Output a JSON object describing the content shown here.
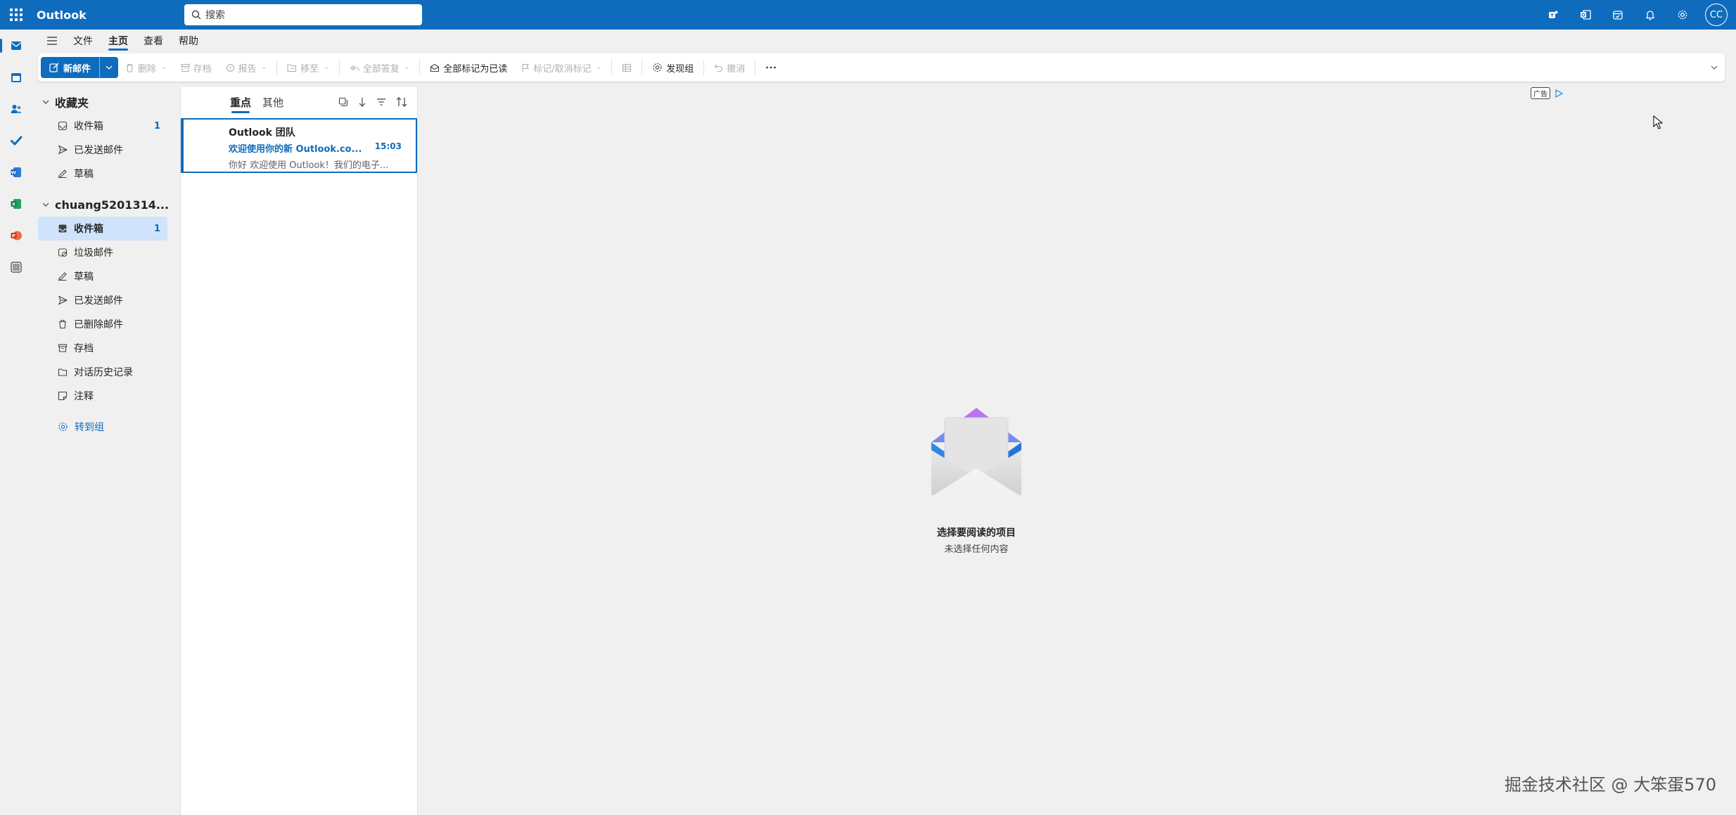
{
  "app": {
    "title": "Outlook"
  },
  "search": {
    "placeholder": "搜索"
  },
  "header": {
    "avatar_initials": "CC"
  },
  "ribbon_tabs": [
    {
      "label": "文件"
    },
    {
      "label": "主页"
    },
    {
      "label": "查看"
    },
    {
      "label": "帮助"
    }
  ],
  "toolbar": {
    "new_mail": "新邮件",
    "delete": "删除",
    "archive": "存档",
    "report": "报告",
    "move": "移至",
    "reply_all": "全部答复",
    "mark_all_read": "全部标记为已读",
    "flag": "标记/取消标记",
    "discover_groups": "发现组",
    "undo": "撤消"
  },
  "favorites": {
    "title": "收藏夹",
    "items": [
      {
        "label": "收件箱",
        "count": "1"
      },
      {
        "label": "已发送邮件"
      },
      {
        "label": "草稿"
      }
    ]
  },
  "account": {
    "title": "chuang5201314...",
    "items": [
      {
        "label": "收件箱",
        "count": "1"
      },
      {
        "label": "垃圾邮件"
      },
      {
        "label": "草稿"
      },
      {
        "label": "已发送邮件"
      },
      {
        "label": "已删除邮件"
      },
      {
        "label": "存档"
      },
      {
        "label": "对话历史记录"
      },
      {
        "label": "注释"
      }
    ],
    "goto_groups": "转到组"
  },
  "message_list": {
    "tabs": [
      {
        "label": "重点"
      },
      {
        "label": "其他"
      }
    ],
    "messages": [
      {
        "sender": "Outlook 团队",
        "subject": "欢迎使用你的新 Outlook.co...",
        "time": "15:03",
        "preview": "你好 欢迎使用 Outlook！我们的电子..."
      }
    ]
  },
  "reading_pane": {
    "ad_label": "广告",
    "empty_title": "选择要阅读的项目",
    "empty_subtitle": "未选择任何内容"
  },
  "watermark": "掘金技术社区 @ 大笨蛋570",
  "colors": {
    "brand": "#0f6cbd",
    "selected_folder": "#cfe4fa"
  }
}
